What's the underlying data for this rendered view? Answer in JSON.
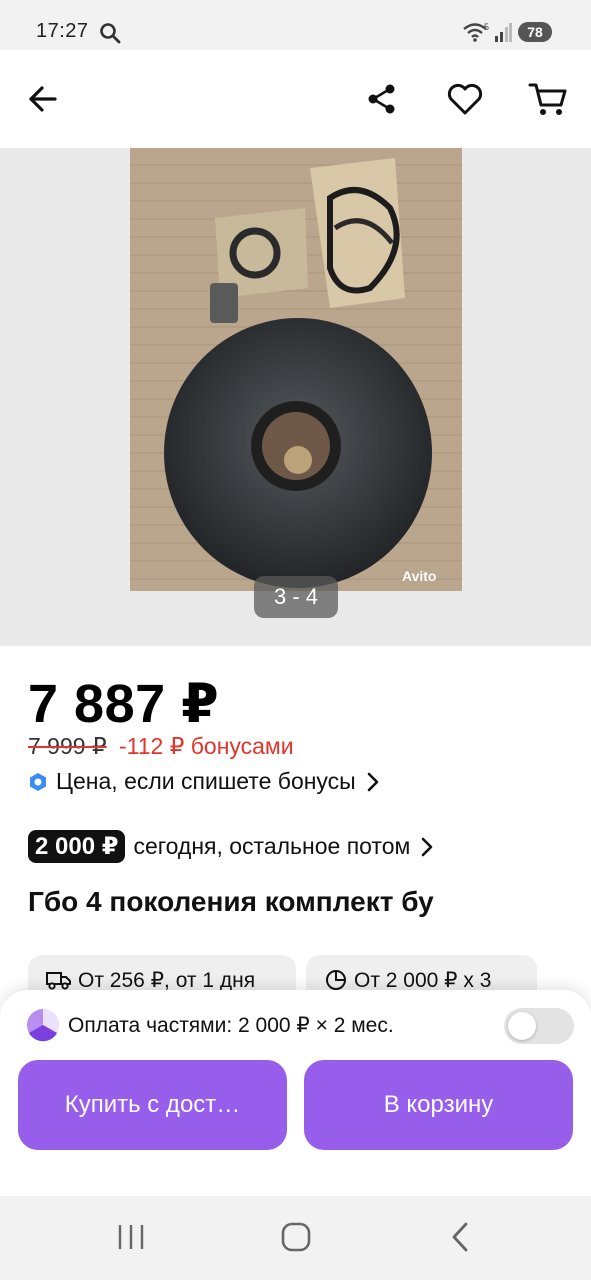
{
  "status_bar": {
    "time": "17:27",
    "battery": "78",
    "network_label": "5"
  },
  "app_bar": {
    "back_icon": "arrow-left-icon",
    "share_icon": "share-icon",
    "favorite_icon": "heart-icon",
    "cart_icon": "cart-icon"
  },
  "gallery": {
    "page_indicator": "3 - 4",
    "watermark": "Avito"
  },
  "product": {
    "price": "7 887 ₽",
    "old_price": "7 999 ₽",
    "bonus_discount": "-112 ₽ бонусами",
    "bonus_link_label": "Цена, если спишете бонусы",
    "installment_badge": "2 000 ₽",
    "installment_text": "сегодня, остальное потом",
    "title": "Гбо 4 поколения комплект бу"
  },
  "chips": [
    {
      "icon": "truck-icon",
      "label": "От 256 ₽, от 1 дня"
    },
    {
      "icon": "pie-chart-icon",
      "label": "От 2 000 ₽ x 3"
    }
  ],
  "bottom_panel": {
    "installment_label": "Оплата частями: 2 000 ₽ × 2 мес.",
    "installment_toggle_on": false,
    "buy_button": "Купить с дост…",
    "cart_button": "В корзину"
  },
  "colors": {
    "accent": "#965eeb",
    "discount": "#e2352b",
    "bonus_icon": "#3b8cf5"
  }
}
